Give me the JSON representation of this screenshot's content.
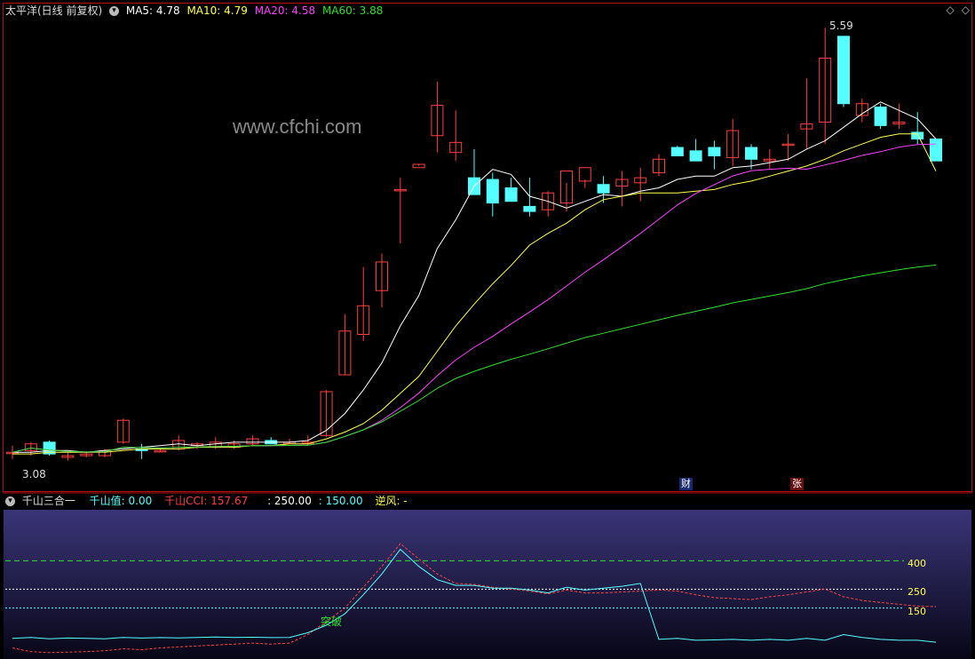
{
  "main_header": {
    "title": "太平洋(日线 前复权)",
    "ma5": "MA5: 4.78",
    "ma10": "MA10: 4.79",
    "ma20": "MA20: 4.58",
    "ma60": "MA60: 3.88"
  },
  "watermark": "www.cfchi.com",
  "price_labels": {
    "high": "5.59",
    "low": "3.08"
  },
  "event_tags": {
    "cai": "财",
    "zhang": "张"
  },
  "indicator_header": {
    "name": "千山三合一",
    "qianshan_value": "千山值: 0.00",
    "qianshan_cci": "千山CCI: 157.67",
    "levels_a": ": 250.00",
    "levels_b": ": 150.00",
    "nifeng": "逆风: -"
  },
  "indicator_labels": {
    "l400": "400",
    "l250": "250",
    "l150": "150",
    "breakout": "突破"
  },
  "colors": {
    "up": "#ff4040",
    "down": "#54ffff",
    "ma5": "#ffffff",
    "ma10": "#ffff50",
    "ma20": "#ff40ff",
    "ma60": "#30e030",
    "border": "#b01010"
  },
  "chart_data": [
    {
      "type": "candlestick",
      "title": "太平洋(日线 前复权)",
      "ylim": [
        3.0,
        5.7
      ],
      "candles": [
        [
          3.12,
          3.16,
          3.08,
          3.12
        ],
        [
          3.13,
          3.18,
          3.1,
          3.17
        ],
        [
          3.18,
          3.19,
          3.1,
          3.11
        ],
        [
          3.09,
          3.12,
          3.07,
          3.1
        ],
        [
          3.1,
          3.12,
          3.09,
          3.11
        ],
        [
          3.1,
          3.14,
          3.09,
          3.13
        ],
        [
          3.18,
          3.32,
          3.17,
          3.31
        ],
        [
          3.14,
          3.17,
          3.08,
          3.13
        ],
        [
          3.13,
          3.14,
          3.12,
          3.13
        ],
        [
          3.14,
          3.22,
          3.13,
          3.19
        ],
        [
          3.16,
          3.18,
          3.14,
          3.17
        ],
        [
          3.15,
          3.21,
          3.14,
          3.18
        ],
        [
          3.15,
          3.19,
          3.14,
          3.17
        ],
        [
          3.17,
          3.22,
          3.16,
          3.2
        ],
        [
          3.19,
          3.21,
          3.17,
          3.17
        ],
        [
          3.18,
          3.2,
          3.17,
          3.18
        ],
        [
          3.18,
          3.22,
          3.16,
          3.18
        ],
        [
          3.22,
          3.49,
          3.21,
          3.48
        ],
        [
          3.58,
          3.94,
          3.58,
          3.84
        ],
        [
          3.82,
          4.22,
          3.78,
          3.99
        ],
        [
          4.08,
          4.3,
          3.98,
          4.25
        ],
        [
          4.68,
          4.75,
          4.36,
          4.68
        ],
        [
          4.81,
          4.83,
          4.82,
          4.83
        ],
        [
          5.0,
          5.32,
          4.9,
          5.18
        ],
        [
          4.9,
          5.15,
          4.85,
          4.96
        ],
        [
          4.75,
          4.92,
          4.68,
          4.65
        ],
        [
          4.74,
          4.78,
          4.52,
          4.6
        ],
        [
          4.69,
          4.75,
          4.66,
          4.61
        ],
        [
          4.58,
          4.75,
          4.52,
          4.55
        ],
        [
          4.56,
          4.67,
          4.52,
          4.66
        ],
        [
          4.6,
          4.72,
          4.55,
          4.79
        ],
        [
          4.73,
          4.74,
          4.69,
          4.81
        ],
        [
          4.71,
          4.76,
          4.6,
          4.66
        ],
        [
          4.7,
          4.79,
          4.58,
          4.74
        ],
        [
          4.72,
          4.81,
          4.61,
          4.75
        ],
        [
          4.78,
          4.89,
          4.76,
          4.86
        ],
        [
          4.93,
          4.94,
          4.9,
          4.88
        ],
        [
          4.91,
          4.98,
          4.86,
          4.85
        ],
        [
          4.93,
          4.97,
          4.8,
          4.88
        ],
        [
          4.87,
          5.1,
          4.82,
          5.03
        ],
        [
          4.93,
          4.95,
          4.8,
          4.86
        ],
        [
          4.85,
          4.92,
          4.8,
          4.86
        ],
        [
          4.95,
          5.01,
          4.85,
          4.95
        ],
        [
          5.04,
          5.34,
          4.92,
          5.07
        ],
        [
          5.08,
          5.64,
          4.95,
          5.46
        ],
        [
          5.59,
          5.59,
          5.17,
          5.19
        ],
        [
          5.12,
          5.22,
          5.08,
          5.19
        ],
        [
          5.17,
          5.19,
          5.04,
          5.06
        ],
        [
          5.07,
          5.19,
          5.04,
          5.08
        ],
        [
          5.02,
          5.14,
          4.95,
          4.98
        ],
        [
          4.98,
          4.97,
          4.85,
          4.85
        ]
      ],
      "ma": {
        "ma5": [
          3.12,
          3.12,
          3.13,
          3.13,
          3.12,
          3.13,
          3.14,
          3.15,
          3.16,
          3.17,
          3.16,
          3.17,
          3.18,
          3.18,
          3.18,
          3.18,
          3.19,
          3.25,
          3.35,
          3.49,
          3.65,
          3.87,
          4.05,
          4.33,
          4.5,
          4.7,
          4.8,
          4.77,
          4.64,
          4.61,
          4.57,
          4.61,
          4.65,
          4.64,
          4.67,
          4.69,
          4.74,
          4.76,
          4.76,
          4.81,
          4.82,
          4.84,
          4.86,
          4.92,
          4.97,
          5.05,
          5.13,
          5.2,
          5.15,
          5.1,
          4.98
        ],
        "ma10": [
          3.11,
          3.11,
          3.12,
          3.12,
          3.12,
          3.12,
          3.13,
          3.14,
          3.14,
          3.14,
          3.15,
          3.15,
          3.15,
          3.16,
          3.16,
          3.17,
          3.17,
          3.2,
          3.24,
          3.29,
          3.37,
          3.47,
          3.57,
          3.72,
          3.87,
          4.0,
          4.12,
          4.23,
          4.35,
          4.42,
          4.48,
          4.56,
          4.62,
          4.64,
          4.66,
          4.66,
          4.66,
          4.67,
          4.68,
          4.71,
          4.73,
          4.76,
          4.79,
          4.82,
          4.86,
          4.91,
          4.95,
          4.99,
          5.01,
          5.01,
          4.79
        ]
      }
    },
    {
      "type": "line",
      "title": "千山三合一",
      "ylim": [
        -100,
        650
      ],
      "reference_lines": [
        400,
        250,
        150
      ],
      "series": [
        {
          "name": "千山值",
          "values": [
            -10,
            -5,
            -12,
            -8,
            -10,
            -12,
            -5,
            -8,
            -6,
            -7,
            -5,
            -3,
            -5,
            -4,
            -6,
            -5,
            20,
            60,
            120,
            220,
            330,
            460,
            370,
            300,
            270,
            270,
            255,
            255,
            245,
            230,
            260,
            245,
            255,
            265,
            280,
            -15,
            -10,
            -20,
            -18,
            -15,
            -20,
            -15,
            -20,
            -10,
            -20,
            10,
            -5,
            -15,
            -20,
            -20,
            -30
          ]
        },
        {
          "name": "千山CCI",
          "values": [
            -60,
            -80,
            -85,
            -82,
            -80,
            -75,
            -65,
            -70,
            -60,
            -55,
            -50,
            -45,
            -40,
            -35,
            -40,
            -35,
            10,
            80,
            150,
            260,
            370,
            490,
            410,
            330,
            280,
            275,
            260,
            250,
            240,
            225,
            245,
            230,
            230,
            235,
            240,
            245,
            240,
            220,
            205,
            200,
            195,
            210,
            220,
            235,
            250,
            210,
            190,
            180,
            170,
            160,
            157.67
          ]
        }
      ]
    }
  ]
}
